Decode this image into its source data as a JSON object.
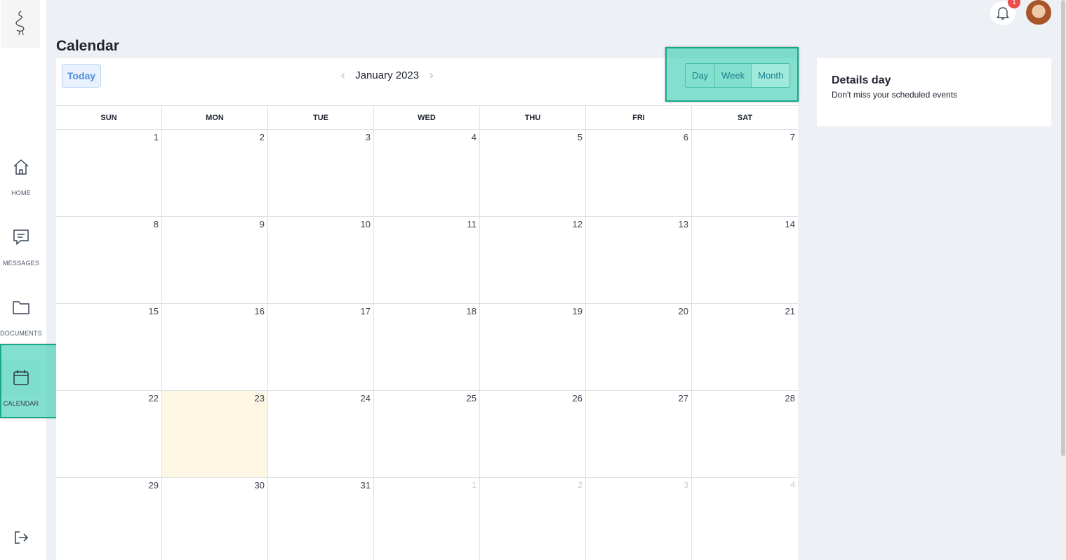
{
  "sidebar": {
    "items": [
      {
        "label": "HOME",
        "icon": "home-icon"
      },
      {
        "label": "MESSAGES",
        "icon": "message-icon"
      },
      {
        "label": "DOCUMENTS",
        "icon": "folder-icon"
      },
      {
        "label": "CALENDAR",
        "icon": "calendar-icon",
        "active": true
      }
    ],
    "logout_icon": "logout-icon"
  },
  "header": {
    "title": "Calendar",
    "notification_count": "1"
  },
  "calendar": {
    "today_label": "Today",
    "month_label": "January 2023",
    "views": [
      "Day",
      "Week",
      "Month"
    ],
    "selected_view": "Month",
    "weekdays": [
      "SUN",
      "MON",
      "TUE",
      "WED",
      "THU",
      "FRI",
      "SAT"
    ],
    "weeks": [
      [
        "1",
        "2",
        "3",
        "4",
        "5",
        "6",
        "7"
      ],
      [
        "8",
        "9",
        "10",
        "11",
        "12",
        "13",
        "14"
      ],
      [
        "15",
        "16",
        "17",
        "18",
        "19",
        "20",
        "21"
      ],
      [
        "22",
        "23",
        "24",
        "25",
        "26",
        "27",
        "28"
      ],
      [
        "29",
        "30",
        "31",
        "1",
        "2",
        "3",
        "4"
      ]
    ],
    "today_date": "23"
  },
  "details": {
    "title": "Details day",
    "subtitle": "Don't miss your scheduled events"
  },
  "colors": {
    "highlight": "#40d0b4",
    "today_bg": "#fdf6e2",
    "today_btn": "#4c8fdc",
    "badge": "#ef4b4b"
  }
}
